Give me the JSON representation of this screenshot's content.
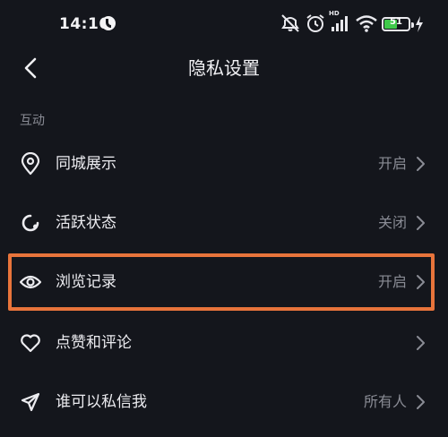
{
  "status_bar": {
    "time": "14:16",
    "network_label": "HD",
    "battery_level": "51",
    "colors": {
      "battery_fill": "#3fc94a"
    }
  },
  "header": {
    "title": "隐私设置",
    "back_icon": "chevron-left-icon"
  },
  "section": {
    "title": "互动"
  },
  "rows": [
    {
      "icon": "location-pin-icon",
      "label": "同城展示",
      "value": "开启"
    },
    {
      "icon": "activity-status-icon",
      "label": "活跃状态",
      "value": "关闭"
    },
    {
      "icon": "eye-icon",
      "label": "浏览记录",
      "value": "开启",
      "highlighted": true
    },
    {
      "icon": "heart-icon",
      "label": "点赞和评论",
      "value": ""
    },
    {
      "icon": "send-icon",
      "label": "谁可以私信我",
      "value": "所有人"
    }
  ],
  "theme": {
    "background": "#14161c",
    "text_primary": "#ececf0",
    "text_secondary": "#8a8c95",
    "highlight": "#e8743b"
  }
}
